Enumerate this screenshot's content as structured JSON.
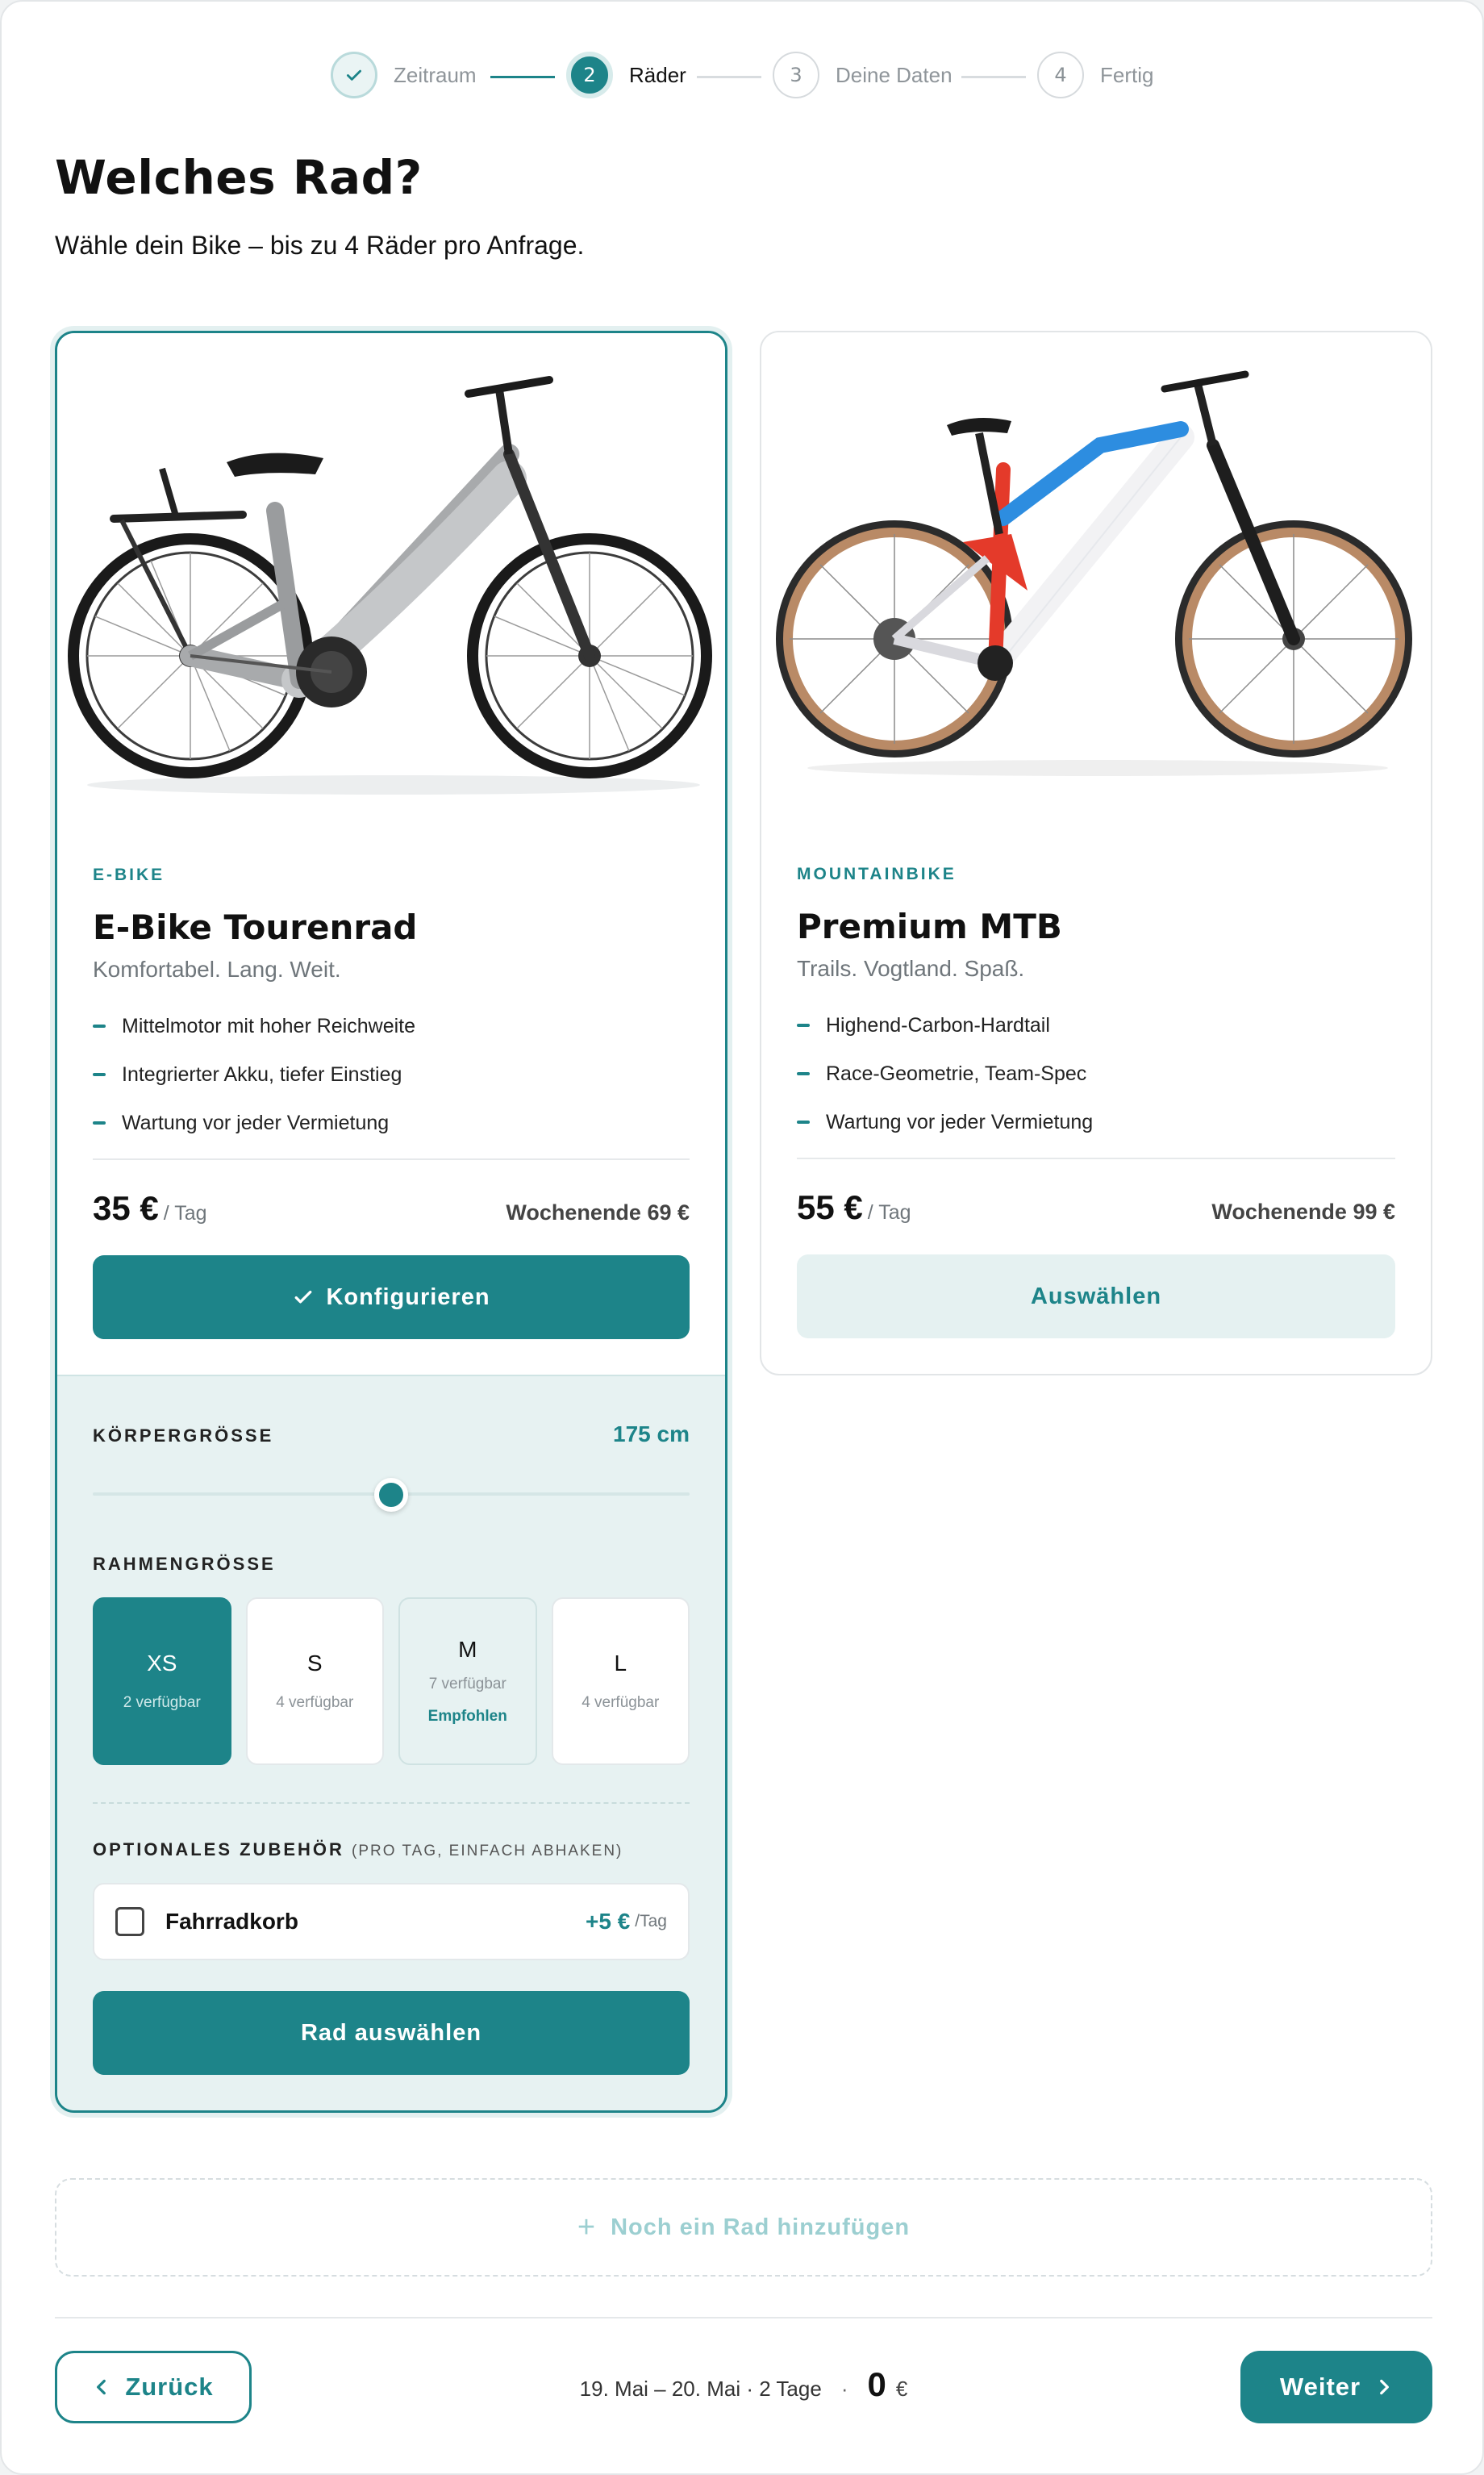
{
  "stepper": {
    "steps": [
      {
        "number": "✓",
        "label": "Zeitraum",
        "state": "done"
      },
      {
        "number": "2",
        "label": "Räder",
        "state": "active"
      },
      {
        "number": "3",
        "label": "Deine Daten",
        "state": "todo"
      },
      {
        "number": "4",
        "label": "Fertig",
        "state": "todo"
      }
    ]
  },
  "page": {
    "title": "Welches Rad?",
    "subtitle": "Wähle dein Bike – bis zu 4 Räder pro Anfrage."
  },
  "bikes": [
    {
      "category": "E-BIKE",
      "title": "E-Bike Tourenrad",
      "tagline": "Komfortabel. Lang. Weit.",
      "features": [
        "Mittelmotor mit hoher Reichweite",
        "Integrierter Akku, tiefer Einstieg",
        "Wartung vor jeder Vermietung"
      ],
      "price": "35 €",
      "per": "/ Tag",
      "weekend": "Wochenende 69 €",
      "button": "Konfigurieren",
      "button_icon": "check-icon",
      "selected": true
    },
    {
      "category": "MOUNTAINBIKE",
      "title": "Premium MTB",
      "tagline": "Trails. Vogtland. Spaß.",
      "features": [
        "Highend-Carbon-Hardtail",
        "Race-Geometrie, Team-Spec",
        "Wartung vor jeder Vermietung"
      ],
      "price": "55 €",
      "per": "/ Tag",
      "weekend": "Wochenende 99 €",
      "button": "Auswählen",
      "selected": false
    }
  ],
  "config": {
    "height_label": "KÖRPERGRÖSSE",
    "height_value": "175 cm",
    "slider_fraction": 0.5,
    "frame_label": "RAHMENGRÖSSE",
    "sizes": [
      {
        "name": "XS",
        "avail": "2 verfügbar",
        "state": "active"
      },
      {
        "name": "S",
        "avail": "4 verfügbar",
        "state": "normal"
      },
      {
        "name": "M",
        "avail": "7 verfügbar",
        "note": "Empfohlen",
        "state": "recommended"
      },
      {
        "name": "L",
        "avail": "4 verfügbar",
        "state": "normal"
      }
    ],
    "accessory_label": "OPTIONALES ZUBEHÖR",
    "accessory_hint": "(PRO TAG, EINFACH ABHAKEN)",
    "accessories": [
      {
        "name": "Fahrradkorb",
        "price": "+5 €",
        "per": "/Tag",
        "checked": false
      }
    ],
    "submit": "Rad auswählen"
  },
  "add_more": {
    "icon": "plus-icon",
    "label": "Noch ein Rad hinzufügen"
  },
  "footer": {
    "back": "Zurück",
    "dates": "19. Mai – 20. Mai · 2 Tage",
    "separator": "·",
    "total": "0",
    "currency": "€",
    "next": "Weiter"
  },
  "colors": {
    "accent": "#1d8489",
    "accent_light": "#e7f2f2"
  }
}
